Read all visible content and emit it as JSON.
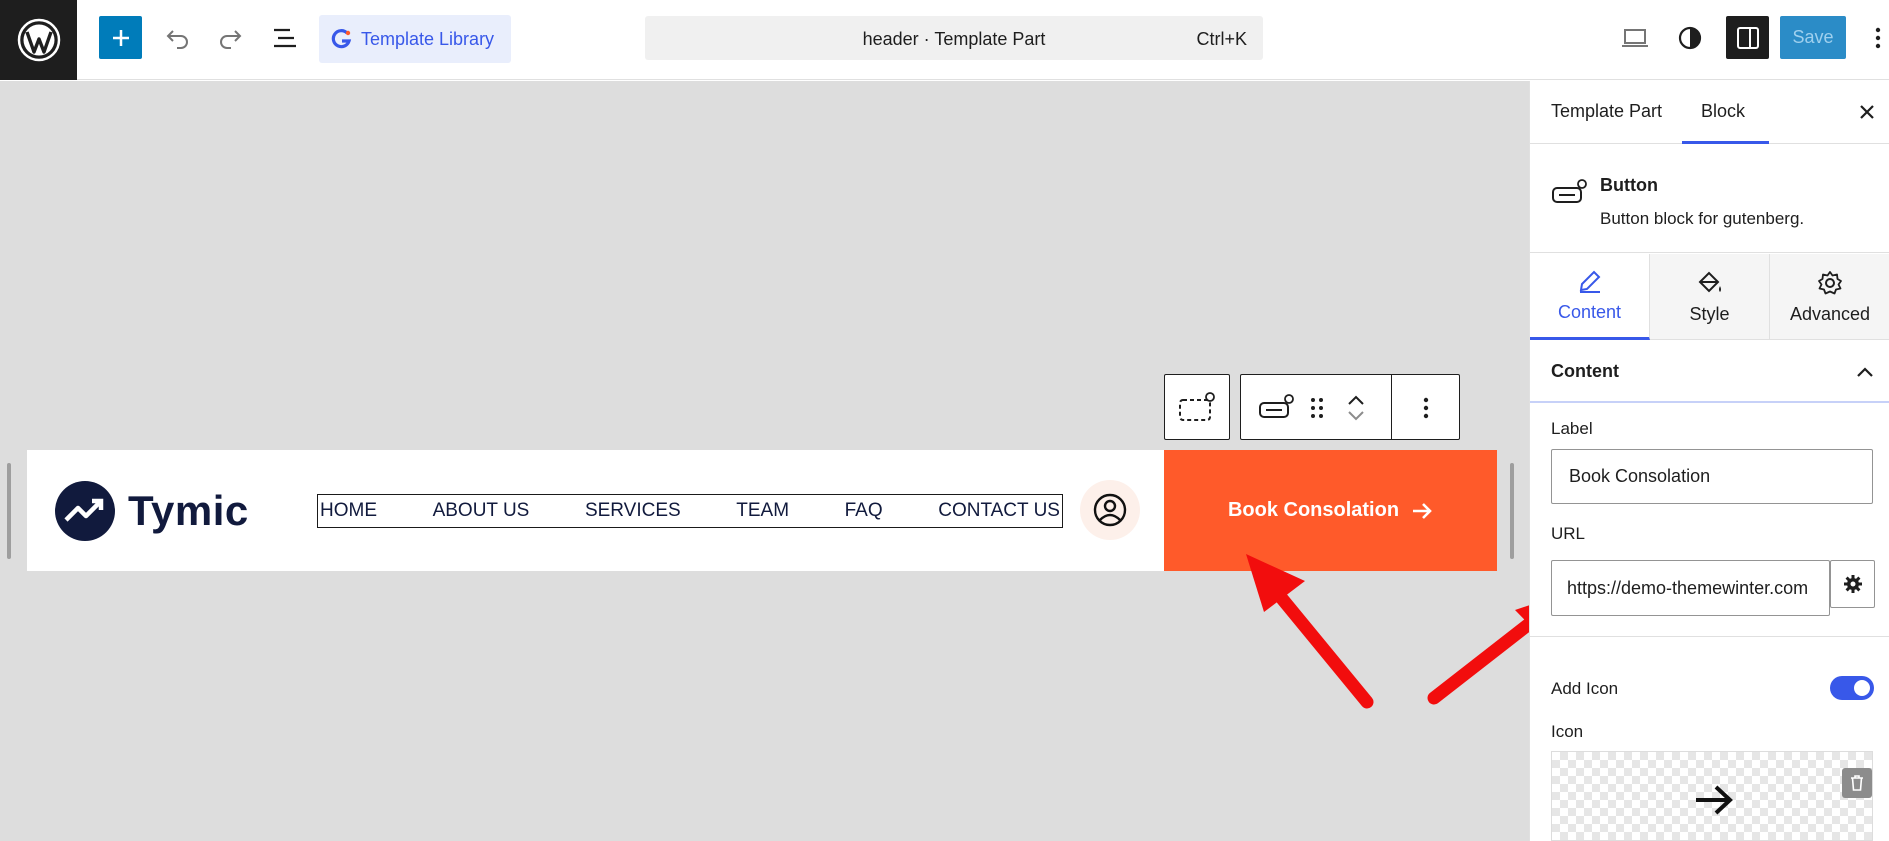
{
  "toolbar": {
    "template_library_label": "Template Library",
    "document_title": "header · Template Part",
    "shortcut": "Ctrl+K",
    "save_label": "Save"
  },
  "canvas": {
    "logo_text": "Tymic",
    "nav_items": [
      "HOME",
      "ABOUT US",
      "SERVICES",
      "TEAM",
      "FAQ",
      "CONTACT US"
    ],
    "cta_label": "Book Consolation",
    "brand_colors": {
      "cta": "#ff5a2a",
      "logo": "#111a3d",
      "accent": "#3858e9"
    }
  },
  "sidebar": {
    "tabs": [
      {
        "label": "Template Part"
      },
      {
        "label": "Block"
      }
    ],
    "active_tab": "Block",
    "block_title": "Button",
    "block_desc": "Button block for gutenberg.",
    "sub_tabs": [
      {
        "label": "Content"
      },
      {
        "label": "Style"
      },
      {
        "label": "Advanced"
      }
    ],
    "active_sub_tab": "Content",
    "section_title": "Content",
    "label_field": {
      "label": "Label",
      "value": "Book Consolation"
    },
    "url_field": {
      "label": "URL",
      "value": "https://demo-themewinter.com"
    },
    "add_icon": {
      "label": "Add Icon",
      "enabled": true
    },
    "icon_label": "Icon"
  }
}
